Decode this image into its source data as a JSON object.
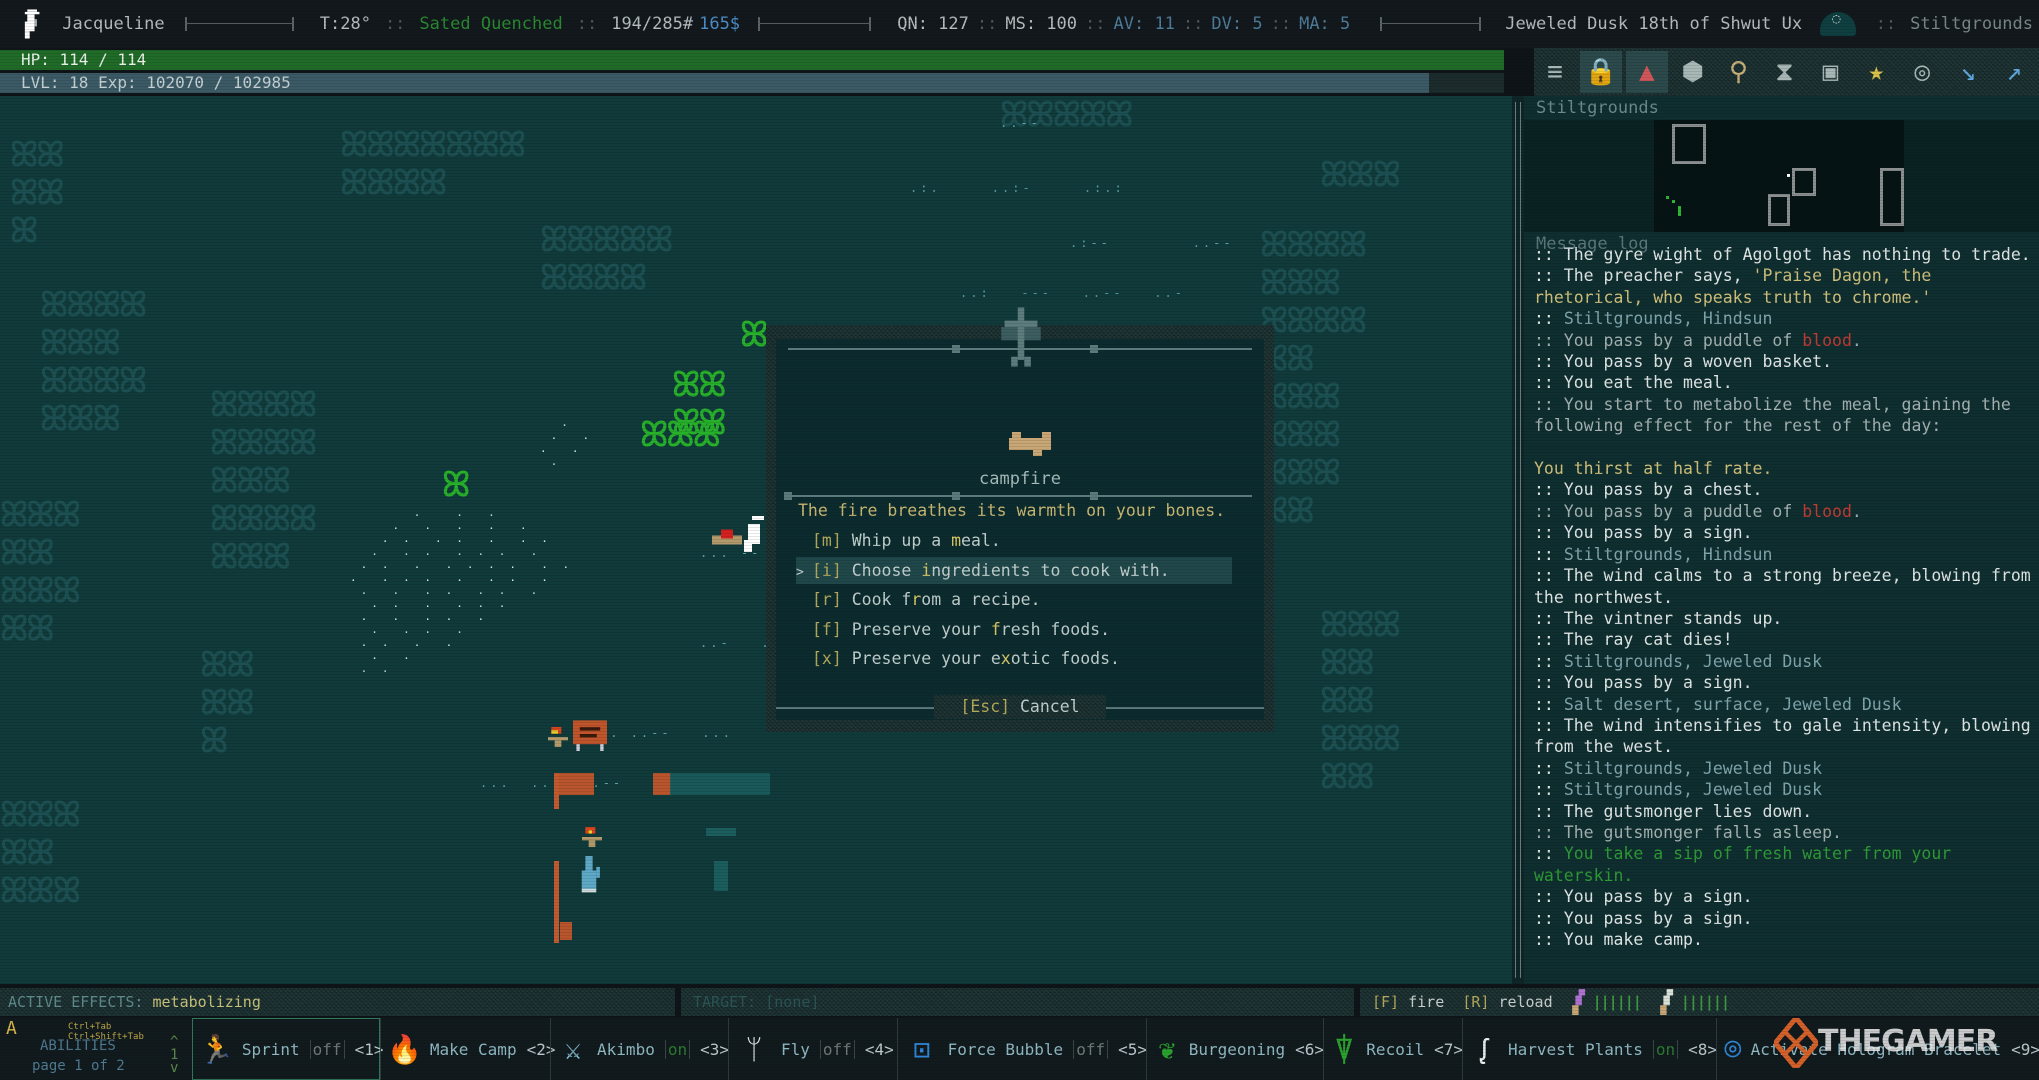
{
  "topbar": {
    "character_name": "Jacqueline",
    "temperature": "T:28°",
    "hunger_thirst": "Sated Quenched",
    "weight": "194/285#",
    "money": "165$",
    "quickness": "QN: 127",
    "move_speed": "MS: 100",
    "armor_value": "AV: 11",
    "dodge_value": "DV: 5",
    "mental_armor": "MA: 5",
    "date": "Jeweled Dusk 18th of Shwut Ux",
    "zone": "Stiltgrounds",
    "separator": "::"
  },
  "vitals": {
    "hp_label": "HP: 114 / 114",
    "hp_fraction": 1.0,
    "xp_label": "LVL: 18 Exp: 102070 / 102985",
    "xp_fraction": 0.95
  },
  "toolbar": {
    "buttons": [
      {
        "name": "menu-icon",
        "glyph": "≡"
      },
      {
        "name": "lock-window-icon",
        "glyph": "🔒"
      },
      {
        "name": "navigation-icon",
        "glyph": "▲"
      },
      {
        "name": "cube-icon",
        "glyph": "⬢"
      },
      {
        "name": "look-magnifier-icon",
        "glyph": "⚲"
      },
      {
        "name": "wait-hourglass-icon",
        "glyph": "⧗"
      },
      {
        "name": "character-sheet-icon",
        "glyph": "▣"
      },
      {
        "name": "quests-star-icon",
        "glyph": "★"
      },
      {
        "name": "compass-icon",
        "glyph": "◎"
      },
      {
        "name": "stairs-down-icon",
        "glyph": "↘"
      },
      {
        "name": "stairs-up-icon",
        "glyph": "↗"
      }
    ]
  },
  "minimap": {
    "title": "Stiltgrounds"
  },
  "message_log": {
    "title": "Message log",
    "lines": [
      {
        "parts": [
          {
            "t": ":: The gyre wight of Agolgot has nothing to trade.",
            "c": ""
          }
        ]
      },
      {
        "parts": [
          {
            "t": ":: The preacher says, ",
            "c": ""
          },
          {
            "t": "'Praise Dagon, the rhetorical, who speaks truth to chrome.'",
            "c": "c-yel"
          }
        ]
      },
      {
        "parts": [
          {
            "t": ":: ",
            "c": ""
          },
          {
            "t": "Stiltgrounds, Hindsun",
            "c": "c-loc"
          }
        ]
      },
      {
        "parts": [
          {
            "t": ":: You pass by a puddle of ",
            "c": "c-dim"
          },
          {
            "t": "blood",
            "c": "c-red"
          },
          {
            "t": ".",
            "c": "c-dim"
          }
        ]
      },
      {
        "parts": [
          {
            "t": ":: You pass by a woven basket.",
            "c": ""
          }
        ]
      },
      {
        "parts": [
          {
            "t": ":: You eat the meal.",
            "c": ""
          }
        ]
      },
      {
        "parts": [
          {
            "t": ":: You start to metabolize the meal, gaining the following effect for the rest of the day:",
            "c": "c-dim"
          }
        ]
      },
      {
        "parts": [
          {
            "t": " ",
            "c": ""
          }
        ]
      },
      {
        "parts": [
          {
            "t": "You thirst at half rate.",
            "c": "c-yel"
          }
        ]
      },
      {
        "parts": [
          {
            "t": ":: You pass by a chest.",
            "c": ""
          }
        ]
      },
      {
        "parts": [
          {
            "t": ":: You pass by a puddle of ",
            "c": "c-dim"
          },
          {
            "t": "blood",
            "c": "c-red"
          },
          {
            "t": ".",
            "c": "c-dim"
          }
        ]
      },
      {
        "parts": [
          {
            "t": ":: You pass by a sign.",
            "c": ""
          }
        ]
      },
      {
        "parts": [
          {
            "t": ":: ",
            "c": ""
          },
          {
            "t": "Stiltgrounds, Hindsun",
            "c": "c-loc"
          }
        ]
      },
      {
        "parts": [
          {
            "t": ":: The wind calms to a strong breeze, blowing from the northwest.",
            "c": ""
          }
        ]
      },
      {
        "parts": [
          {
            "t": ":: The vintner stands up.",
            "c": ""
          }
        ]
      },
      {
        "parts": [
          {
            "t": ":: The ray cat dies!",
            "c": ""
          }
        ]
      },
      {
        "parts": [
          {
            "t": ":: ",
            "c": ""
          },
          {
            "t": "Stiltgrounds, Jeweled Dusk",
            "c": "c-loc"
          }
        ]
      },
      {
        "parts": [
          {
            "t": ":: You pass by a sign.",
            "c": ""
          }
        ]
      },
      {
        "parts": [
          {
            "t": ":: ",
            "c": ""
          },
          {
            "t": "Salt desert, surface, Jeweled Dusk",
            "c": "c-loc"
          }
        ]
      },
      {
        "parts": [
          {
            "t": ":: The wind intensifies to gale intensity, blowing from the west.",
            "c": ""
          }
        ]
      },
      {
        "parts": [
          {
            "t": ":: ",
            "c": ""
          },
          {
            "t": "Stiltgrounds, Jeweled Dusk",
            "c": "c-loc"
          }
        ]
      },
      {
        "parts": [
          {
            "t": ":: ",
            "c": ""
          },
          {
            "t": "Stiltgrounds, Jeweled Dusk",
            "c": "c-loc"
          }
        ]
      },
      {
        "parts": [
          {
            "t": ":: The gutsmonger lies down.",
            "c": ""
          }
        ]
      },
      {
        "parts": [
          {
            "t": ":: The gutsmonger falls asleep.",
            "c": "c-dim"
          }
        ]
      },
      {
        "parts": [
          {
            "t": ":: ",
            "c": ""
          },
          {
            "t": "You take a sip of fresh water from your waterskin.",
            "c": "c-grn"
          }
        ]
      },
      {
        "parts": [
          {
            "t": ":: You pass by a sign.",
            "c": ""
          }
        ]
      },
      {
        "parts": [
          {
            "t": ":: You pass by a sign.",
            "c": ""
          }
        ]
      },
      {
        "parts": [
          {
            "t": ":: You make camp.",
            "c": ""
          }
        ]
      }
    ]
  },
  "modal": {
    "title": "campfire",
    "description": "The fire breathes its warmth on your bones.",
    "selected_index": 1,
    "selection_pointer": ">",
    "options": [
      {
        "key": "[m]",
        "pre": "Whip up a ",
        "hl": "m",
        "post": "eal."
      },
      {
        "key": "[i]",
        "pre": "Choose ",
        "hl": "i",
        "post": "ngredients to cook with."
      },
      {
        "key": "[r]",
        "pre": "Cook f",
        "hl": "r",
        "post": "om a recipe."
      },
      {
        "key": "[f]",
        "pre": "Preserve your ",
        "hl": "f",
        "post": "resh foods."
      },
      {
        "key": "[x]",
        "pre": "Preserve your e",
        "hl": "x",
        "post": "otic foods."
      }
    ],
    "cancel_key": "[Esc]",
    "cancel_label": "Cancel"
  },
  "status": {
    "active_effects_label": "ACTIVE EFFECTS:",
    "active_effects_value": "metabolizing",
    "target_label": "TARGET: [none]",
    "fire_key": "[F]",
    "fire_label": "fire",
    "reload_key": "[R]",
    "reload_label": "reload",
    "ammo_1": "||||||",
    "ammo_2": "||||||"
  },
  "abilities": {
    "letter": "A",
    "keys_hint": "Ctrl+Tab Ctrl+Shift+Tab",
    "label": "ABILITIES",
    "page": "page 1 of 2",
    "page_number": "1",
    "up_arrow": "^",
    "down_arrow": "v",
    "items": [
      {
        "name": "Sprint",
        "toggle": "off",
        "hotkey": "<1>",
        "icon": "sprint-icon",
        "glyph": "🏃",
        "color": "#cfe0d8",
        "selected": true
      },
      {
        "name": "Make Camp",
        "toggle": "",
        "hotkey": "<2>",
        "icon": "campfire-icon",
        "glyph": "🔥",
        "color": "#d9732f",
        "selected": false
      },
      {
        "name": "Akimbo",
        "toggle": "on",
        "hotkey": "<3>",
        "icon": "akimbo-icon",
        "glyph": "⚔",
        "color": "#8ec9db",
        "selected": false
      },
      {
        "name": "Fly",
        "toggle": "off",
        "hotkey": "<4>",
        "icon": "wings-icon",
        "glyph": "ᛘ",
        "color": "#d6e1e6",
        "selected": false
      },
      {
        "name": "Force Bubble",
        "toggle": "off",
        "hotkey": "<5>",
        "icon": "force-bubble-icon",
        "glyph": "⊡",
        "color": "#2f86d6",
        "selected": false
      },
      {
        "name": "Burgeoning",
        "toggle": "",
        "hotkey": "<6>",
        "icon": "sprout-icon",
        "glyph": "❦",
        "color": "#2aa12f",
        "selected": false
      },
      {
        "name": "Recoil",
        "toggle": "",
        "hotkey": "<7>",
        "icon": "recoil-icon",
        "glyph": "⍒",
        "color": "#2aa12f",
        "selected": false
      },
      {
        "name": "Harvest Plants",
        "toggle": "on",
        "hotkey": "<8>",
        "icon": "sickle-icon",
        "glyph": "ᶘ",
        "color": "#e6eeee",
        "selected": false
      },
      {
        "name": "Activate Hologram Bracelet",
        "toggle": "",
        "hotkey": "<9>",
        "icon": "bracelet-icon",
        "glyph": "⌾",
        "color": "#2f86d6",
        "selected": false
      }
    ]
  },
  "watermark": "THEGAMER"
}
